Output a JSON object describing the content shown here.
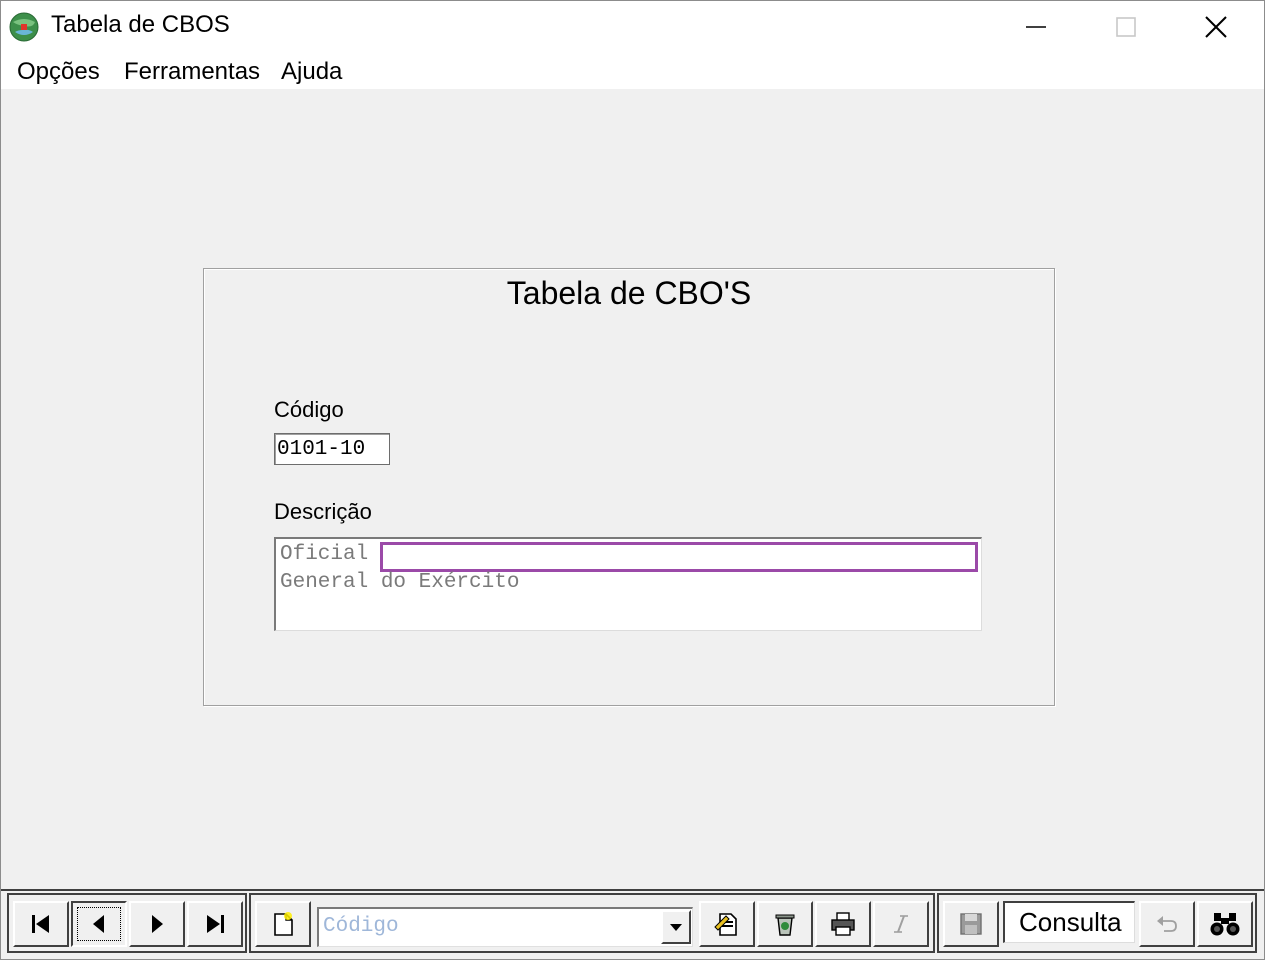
{
  "window": {
    "title": "Tabela de CBOS",
    "controls": [
      "minimize",
      "maximize",
      "close"
    ]
  },
  "menubar": {
    "items": [
      {
        "label": "Opções"
      },
      {
        "label": "Ferramentas"
      },
      {
        "label": "Ajuda"
      }
    ]
  },
  "form": {
    "title": "Tabela de CBO'S",
    "code_label": "Código",
    "code_value": "0101-10",
    "description_label": "Descrição",
    "description_lines": [
      "Oficial",
      "General do Exército"
    ]
  },
  "toolbar": {
    "nav_buttons": [
      "first-record-icon",
      "previous-record-icon",
      "next-record-icon",
      "last-record-icon"
    ],
    "search_field_value": "Código",
    "mode_value": "Consulta",
    "icons": [
      "new-document-icon",
      "edit-document-icon",
      "delete-icon",
      "print-icon",
      "italic-icon",
      "save-icon",
      "undo-icon",
      "binoculars-icon"
    ]
  },
  "colors": {
    "highlight_border": "#9b4aa8",
    "combo_placeholder": "#9fb7d9",
    "description_text": "#7a7a7a"
  }
}
